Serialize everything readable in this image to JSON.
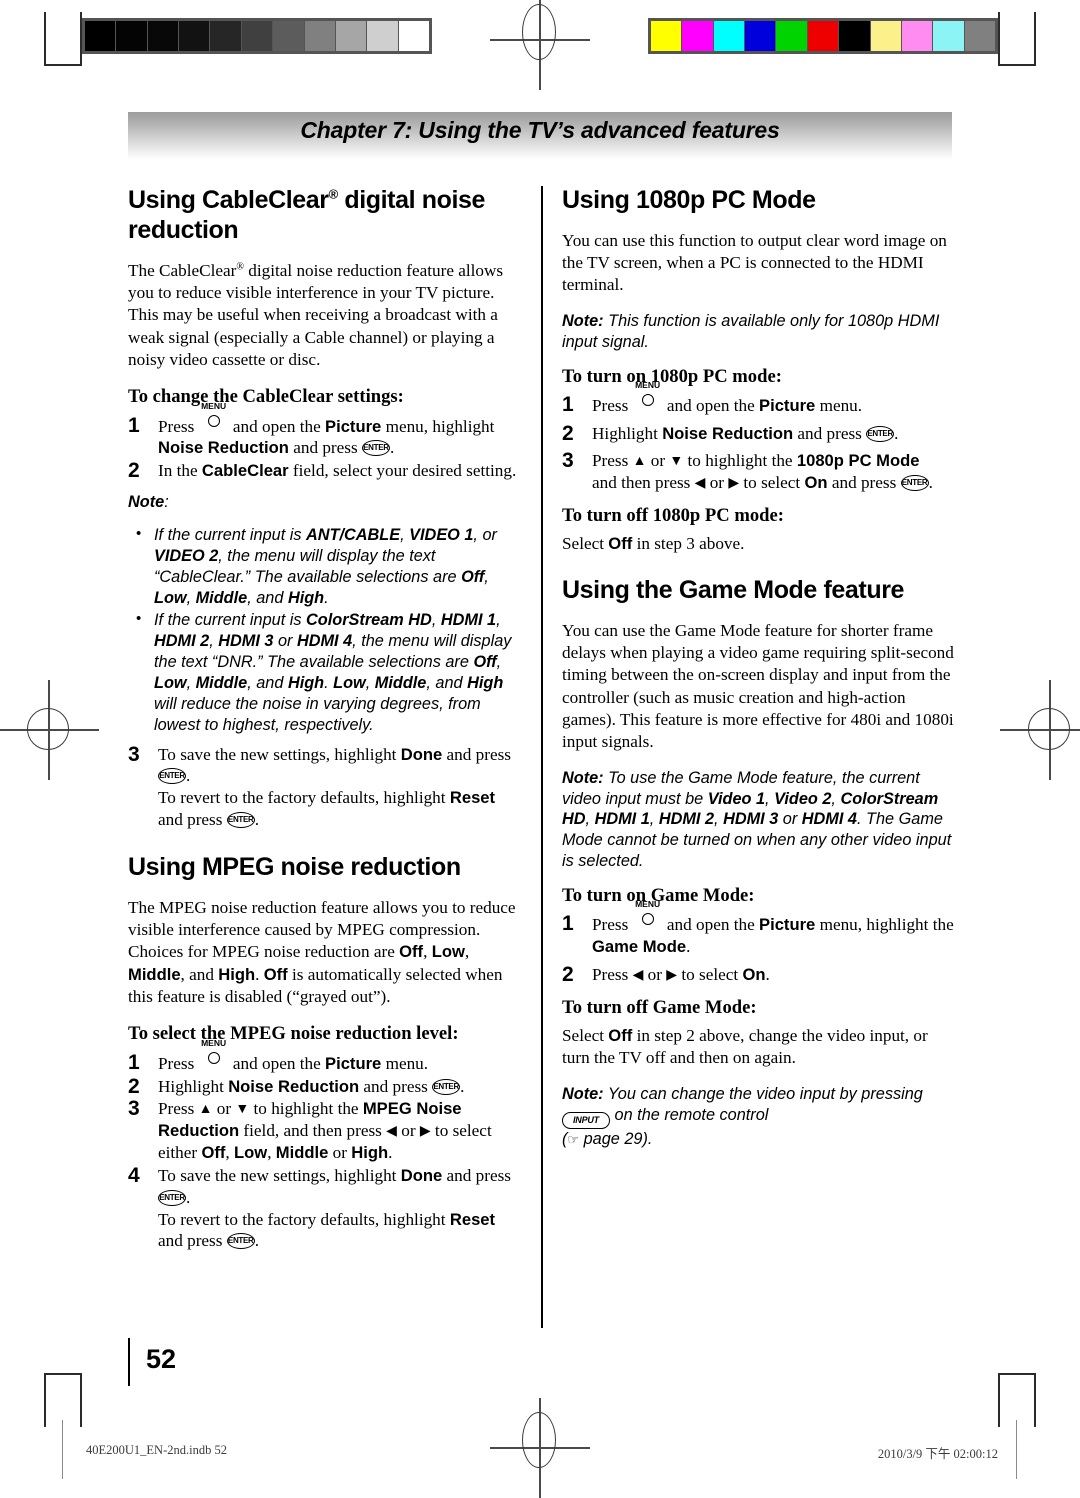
{
  "calibration": {
    "gray_bar": [
      "#000000",
      "#040404",
      "#080808",
      "#121212",
      "#262626",
      "#404040",
      "#5c5c5c",
      "#808080",
      "#a6a6a6",
      "#cfcfcf",
      "#ffffff"
    ],
    "color_bar": [
      "#ffff00",
      "#ff00ff",
      "#00ffff",
      "#0000dd",
      "#00d400",
      "#ee0000",
      "#000000",
      "#fbf08a",
      "#ff8cf0",
      "#8cf4f4",
      "#808080"
    ]
  },
  "header": {
    "chapter": "Chapter 7: Using the TV’s advanced features"
  },
  "left_column": {
    "section1_title_line1": "Using CableClear",
    "section1_title_reg": "®",
    "section1_title_line2": " digital noise reduction",
    "section1_body": "The CableClear® digital noise reduction feature allows you to reduce visible interference in your TV picture. This may be useful when receiving a broadcast with a weak signal (especially a Cable channel) or playing a noisy video cassette or disc.",
    "sub1": "To change the CableClear settings:",
    "step1_a": "Press",
    "step1_b": "and open the",
    "step1_picture": "Picture",
    "step1_c": "menu, highlight",
    "step1_noise": "Noise Reduction",
    "step1_d": "and press",
    "step1_e": ".",
    "step2_a": "In the",
    "step2_cableclear": "CableClear",
    "step2_b": "field, select your desired setting.",
    "note_label": "Note",
    "note_colon": ":",
    "bullet1": [
      {
        "t": "If the current input is ",
        "b": false
      },
      {
        "t": "ANT/CABLE",
        "b": true
      },
      {
        "t": ", ",
        "b": false
      },
      {
        "t": "VIDEO 1",
        "b": true
      },
      {
        "t": ", or ",
        "b": false
      },
      {
        "t": "VIDEO 2",
        "b": true
      },
      {
        "t": ", the menu will display the text “CableClear.” The available selections are ",
        "b": false
      },
      {
        "t": "Off",
        "b": true
      },
      {
        "t": ", ",
        "b": false
      },
      {
        "t": "Low",
        "b": true
      },
      {
        "t": ", ",
        "b": false
      },
      {
        "t": "Middle",
        "b": true
      },
      {
        "t": ", and ",
        "b": false
      },
      {
        "t": "High",
        "b": true
      },
      {
        "t": ".",
        "b": false
      }
    ],
    "bullet2": [
      {
        "t": "If the current input is ",
        "b": false
      },
      {
        "t": "ColorStream HD",
        "b": true
      },
      {
        "t": ", ",
        "b": false
      },
      {
        "t": "HDMI 1",
        "b": true
      },
      {
        "t": ", ",
        "b": false
      },
      {
        "t": "HDMI 2",
        "b": true
      },
      {
        "t": ", ",
        "b": false
      },
      {
        "t": "HDMI 3",
        "b": true
      },
      {
        "t": " or ",
        "b": false
      },
      {
        "t": "HDMI 4",
        "b": true
      },
      {
        "t": ", the menu will display the text “DNR.” The available selections are ",
        "b": false
      },
      {
        "t": "Off",
        "b": true
      },
      {
        "t": ", ",
        "b": false
      },
      {
        "t": "Low",
        "b": true
      },
      {
        "t": ", ",
        "b": false
      },
      {
        "t": "Middle",
        "b": true
      },
      {
        "t": ", and ",
        "b": false
      },
      {
        "t": "High",
        "b": true
      },
      {
        "t": ". ",
        "b": false
      },
      {
        "t": "Low",
        "b": true
      },
      {
        "t": ", ",
        "b": false
      },
      {
        "t": "Middle",
        "b": true
      },
      {
        "t": ", and ",
        "b": false
      },
      {
        "t": "High",
        "b": true
      },
      {
        "t": " will reduce the noise in varying degrees, from lowest to highest, respectively.",
        "b": false
      }
    ],
    "step3_a": "To save the new settings, highlight",
    "step3_done": "Done",
    "step3_b": "and press",
    "step3_c": "To revert to the factory defaults, highlight",
    "step3_reset": "Reset",
    "step3_d": "and press",
    "section2_title": "Using MPEG noise reduction",
    "section2_body_parts": [
      {
        "t": "The MPEG noise reduction feature allows you to reduce visible interference caused by MPEG compression. Choices for MPEG noise reduction are ",
        "b": false
      },
      {
        "t": "Off",
        "b": true
      },
      {
        "t": ", ",
        "b": false
      },
      {
        "t": "Low",
        "b": true
      },
      {
        "t": ", ",
        "b": false
      },
      {
        "t": "Middle",
        "b": true
      },
      {
        "t": ", and ",
        "b": false
      },
      {
        "t": "High",
        "b": true
      },
      {
        "t": ". ",
        "b": false
      },
      {
        "t": "Off",
        "b": true
      },
      {
        "t": " is automatically selected when this feature is disabled (“grayed out”).",
        "b": false
      }
    ],
    "sub2": "To select the MPEG noise reduction level:",
    "m_step1_a": "Press",
    "m_step1_b": "and open the",
    "m_step1_picture": "Picture",
    "m_step1_c": "menu.",
    "m_step2_a": "Highlight",
    "m_step2_noise": "Noise Reduction",
    "m_step2_b": "and press",
    "m_step3_a": "Press",
    "m_step3_b": "or",
    "m_step3_c": "to highlight the",
    "m_step3_field": "MPEG Noise Reduction",
    "m_step3_d": "field, and then press",
    "m_step3_e": "or",
    "m_step3_f": "to select either",
    "m_step3_off": "Off",
    "m_step3_low": "Low",
    "m_step3_middle": "Middle",
    "m_step3_or": "or",
    "m_step3_high": "High",
    "m_step4_a": "To save the new settings, highlight",
    "m_step4_done": "Done",
    "m_step4_b": "and press",
    "m_step4_c": "To revert to the factory defaults, highlight",
    "m_step4_reset": "Reset",
    "m_step4_d": "and press"
  },
  "right_column": {
    "section1_title": "Using 1080p PC Mode",
    "section1_body": "You can use this function to output clear word image on the TV screen, when a PC is connected to the HDMI terminal.",
    "note1_label": "Note:",
    "note1_text": " This function is available only for 1080p HDMI input signal.",
    "sub1": "To turn on 1080p PC mode:",
    "p_step1_a": "Press",
    "p_step1_b": "and open the",
    "p_step1_picture": "Picture",
    "p_step1_c": "menu.",
    "p_step2_a": "Highlight",
    "p_step2_noise": "Noise Reduction",
    "p_step2_b": "and press",
    "p_step3_a": "Press",
    "p_step3_b": "or",
    "p_step3_c": "to highlight the",
    "p_step3_mode": "1080p PC Mode",
    "p_step3_d": "and then press",
    "p_step3_e": "or",
    "p_step3_f": "to select",
    "p_step3_on": "On",
    "p_step3_g": "and press",
    "sub2": "To turn off 1080p PC mode:",
    "sub2_body_a": "Select",
    "sub2_off": "Off",
    "sub2_body_b": "in step 3 above.",
    "section2_title": "Using the Game Mode feature",
    "section2_body": "You can use the Game Mode feature for shorter frame delays when playing a video game requiring split-second timing between the on-screen display and input from the controller (such as music creation and high-action games). This feature is more effective for 480i and 1080i input signals.",
    "note2_label": "Note:",
    "note2_parts": [
      {
        "t": " To use the Game Mode feature, the current video input must be ",
        "b": false
      },
      {
        "t": "Video 1",
        "b": true
      },
      {
        "t": ", ",
        "b": false
      },
      {
        "t": "Video 2",
        "b": true
      },
      {
        "t": ", ",
        "b": false
      },
      {
        "t": "ColorStream HD",
        "b": true
      },
      {
        "t": ", ",
        "b": false
      },
      {
        "t": "HDMI 1",
        "b": true
      },
      {
        "t": ", ",
        "b": false
      },
      {
        "t": "HDMI 2",
        "b": true
      },
      {
        "t": ", ",
        "b": false
      },
      {
        "t": "HDMI 3",
        "b": true
      },
      {
        "t": " or ",
        "b": false
      },
      {
        "t": "HDMI 4",
        "b": true
      },
      {
        "t": ". The Game Mode cannot be turned on when any other video input is selected.",
        "b": false
      }
    ],
    "sub3": "To turn on Game Mode:",
    "g_step1_a": "Press",
    "g_step1_b": "and open the",
    "g_step1_picture": "Picture",
    "g_step1_c": "menu, highlight the",
    "g_step1_game": "Game Mode",
    "g_step1_d": ".",
    "g_step2_a": "Press",
    "g_step2_b": "or",
    "g_step2_c": "to select",
    "g_step2_on": "On",
    "g_step2_d": ".",
    "sub4": "To turn off Game Mode:",
    "sub4_body_a": "Select",
    "sub4_off": "Off",
    "sub4_body_b": "in step 2 above, change the video input, or turn the TV off and then on again.",
    "note3_label": "Note:",
    "note3_a": " You can change the video input by pressing",
    "note3_input_key": "INPUT",
    "note3_b": "on the remote control",
    "note3_c": "page 29)."
  },
  "keys": {
    "menu_label": "MENU",
    "enter_label": "ENTER",
    "input_label": "INPUT",
    "arrow_up": "▲",
    "arrow_down": "▼",
    "arrow_left": "◀",
    "arrow_right": "▶",
    "hand_pointer": "☞"
  },
  "footer": {
    "page_number": "52",
    "filename": "40E200U1_EN-2nd.indb   52",
    "timestamp": "2010/3/9   下午 02:00:12"
  }
}
